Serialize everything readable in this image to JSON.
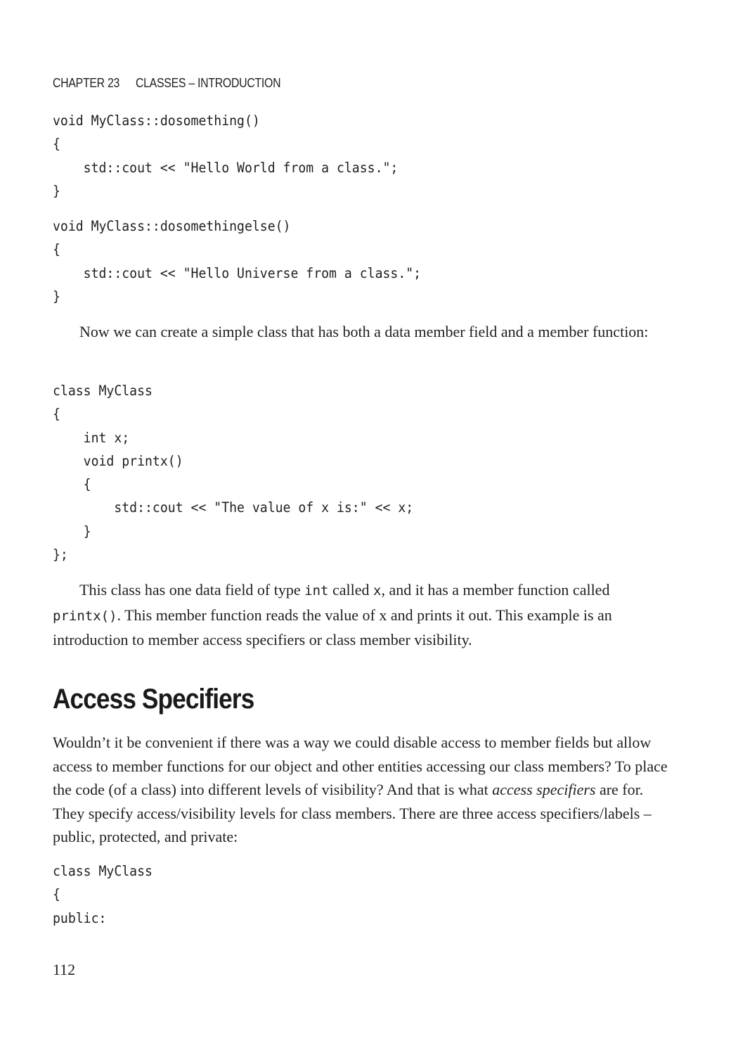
{
  "header": {
    "chapter": "CHAPTER 23",
    "title": "CLASSES – INTRODUCTION"
  },
  "code_block_1": "void MyClass::dosomething()\n{\n    std::cout << \"Hello World from a class.\";\n}",
  "code_block_2": "void MyClass::dosomethingelse()\n{\n    std::cout << \"Hello Universe from a class.\";\n}",
  "para_1": "Now we can create a simple class that has both a data member field and a member function:",
  "code_block_3": "class MyClass\n{\n    int x;\n    void printx()\n    {\n        std::cout << \"The value of x is:\" << x;\n    }\n};",
  "para_2": {
    "t1": "This class has one data field of type ",
    "c1": "int",
    "t2": " called ",
    "c2": "x",
    "t3": ", and it has a member function called ",
    "c3": "printx()",
    "t4": ". This member function reads the value of x and prints it out. This example is an introduction to member access specifiers or class member visibility."
  },
  "section_heading": "Access Specifiers",
  "para_3": {
    "t1": "Wouldn’t it be convenient if there was a way we could disable access to member fields but allow access to member functions for our object and other entities accessing our class members? To place the code (of a class) into different levels of visibility? And that is what ",
    "em": "access specifiers",
    "t2": " are for. They specify access/visibility levels for class members. There are three access specifiers/labels – public, protected, and private:"
  },
  "code_block_4": "class MyClass\n{\npublic:",
  "page_number": "112"
}
